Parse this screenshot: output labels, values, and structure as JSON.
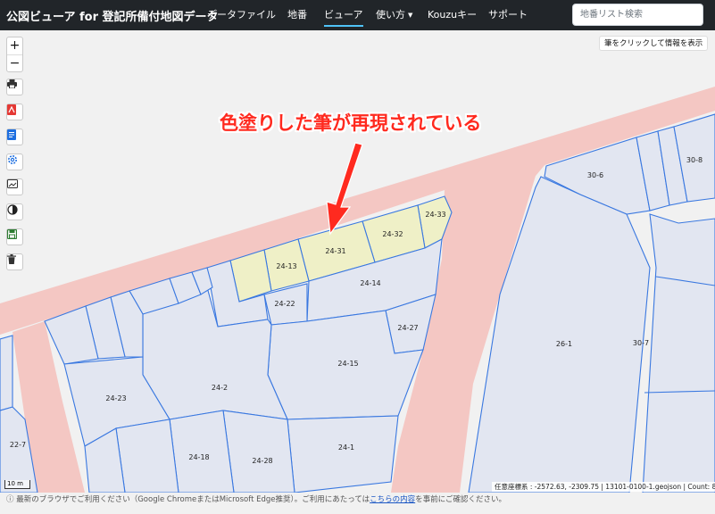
{
  "navbar": {
    "brand": "公図ビューア for 登記所備付地図データ",
    "items": [
      {
        "label": "データファイル",
        "active": false
      },
      {
        "label": "地番",
        "active": false
      },
      {
        "label": "ビューア",
        "active": true
      },
      {
        "label": "使い方",
        "active": false,
        "dropdown": true
      },
      {
        "label": "Kouzuキー",
        "active": false
      },
      {
        "label": "サポート",
        "active": false
      }
    ],
    "search_placeholder": "地番リスト検索"
  },
  "map": {
    "hint": "筆をクリックして情報を表示",
    "annotation": "色塗りした筆が再現されている",
    "scale": "10 m",
    "coords": "任意座標系 : -2572.63, -2309.75  |  13101-0100-1.geojson  |  Count: 859",
    "parcels": [
      "24-33",
      "24-32",
      "24-31",
      "24-13",
      "24-14",
      "24-22",
      "24-27",
      "24-15",
      "24-2",
      "24-23",
      "24-1",
      "24-18",
      "24-28",
      "22-7",
      "26-1",
      "30-7",
      "30-6",
      "30-8"
    ],
    "colors": {
      "road": "#f4c7c3",
      "parcel_fill": "#e2e6f1",
      "parcel_stroke": "#3a78e0",
      "colored_fill": "#eff0c7",
      "annotation": "#ff2a1f"
    }
  },
  "toolbar": {
    "zoom_in": "+",
    "zoom_out": "−",
    "tools": [
      "printer-icon",
      "pdf-icon",
      "document-icon",
      "gear-icon",
      "image-icon",
      "contrast-icon",
      "save-icon",
      "trash-icon"
    ]
  },
  "footer": {
    "prefix": "ⓘ 最新のブラウザでご利用ください（Google ChromeまたはMicrosoft Edge推奨）。ご利用にあたっては",
    "link": "こちらの内容",
    "suffix": "を事前にご確認ください。"
  }
}
